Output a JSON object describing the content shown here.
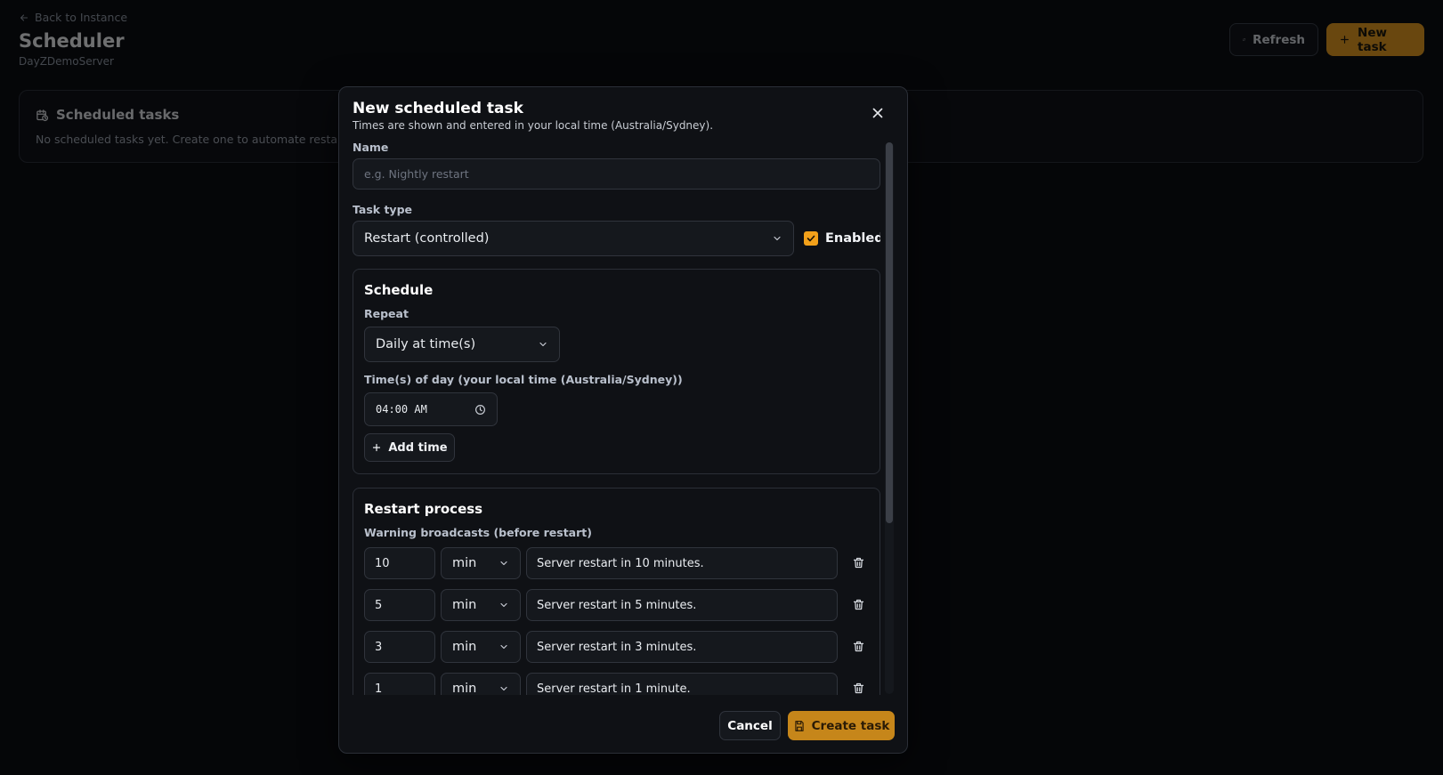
{
  "header": {
    "back_label": "Back to Instance",
    "title": "Scheduler",
    "subtitle": "DayZDemoServer",
    "refresh_label": "Refresh",
    "new_task_label": "New task"
  },
  "tasks_card": {
    "title": "Scheduled tasks",
    "empty_message": "No scheduled tasks yet. Create one to automate restarts, s"
  },
  "modal": {
    "title": "New scheduled task",
    "description": "Times are shown and entered in your local time (Australia/Sydney).",
    "name_label": "Name",
    "name_placeholder": "e.g. Nightly restart",
    "name_value": "",
    "task_type_label": "Task type",
    "task_type_value": "Restart (controlled)",
    "enabled_label": "Enabled",
    "enabled": true,
    "schedule": {
      "title": "Schedule",
      "repeat_label": "Repeat",
      "repeat_value": "Daily at time(s)",
      "times_label": "Time(s) of day (your local time (Australia/Sydney))",
      "times": [
        "04:00 AM"
      ],
      "add_time_label": "Add time"
    },
    "restart": {
      "title": "Restart process",
      "warnings_label": "Warning broadcasts (before restart)",
      "warnings": [
        {
          "amount": "10",
          "unit": "min",
          "message": "Server restart in 10 minutes."
        },
        {
          "amount": "5",
          "unit": "min",
          "message": "Server restart in 5 minutes."
        },
        {
          "amount": "3",
          "unit": "min",
          "message": "Server restart in 3 minutes."
        },
        {
          "amount": "1",
          "unit": "min",
          "message": "Server restart in 1 minute."
        }
      ]
    },
    "cancel_label": "Cancel",
    "create_label": "Create task"
  },
  "colors": {
    "accent": "#f3a11a",
    "background": "#050608",
    "surface": "#0f1115",
    "border": "#2b2f37"
  },
  "icons": {
    "back": "arrow-left-icon",
    "refresh": "refresh-icon",
    "new_task": "plus-icon",
    "calendar": "calendar-clock-icon",
    "close": "close-icon",
    "chevron": "chevron-down-icon",
    "check": "check-icon",
    "clock": "clock-icon",
    "trash": "trash-icon",
    "save": "save-icon"
  }
}
